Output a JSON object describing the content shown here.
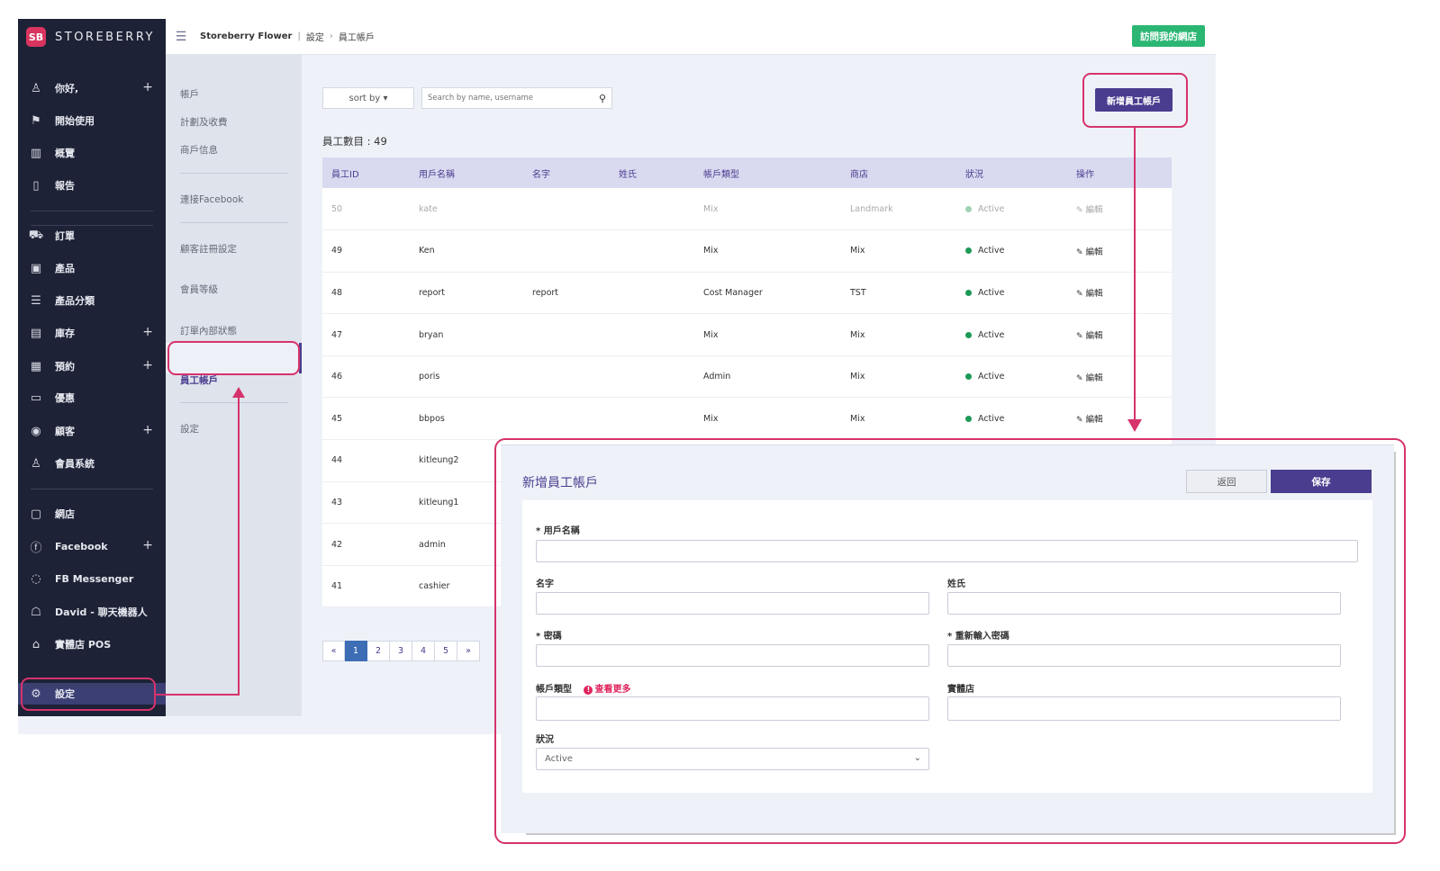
{
  "brand": {
    "logo": "SB",
    "name": "STOREBERRY"
  },
  "sidebar": {
    "items": [
      {
        "icon": "user-icon",
        "glyph": "♙",
        "label": "你好,",
        "plus": true
      },
      {
        "icon": "flag-icon",
        "glyph": "⚑",
        "label": "開始使用",
        "plus": false
      },
      {
        "icon": "chart-icon",
        "glyph": "▥",
        "label": "概覽",
        "plus": false
      },
      {
        "icon": "document-icon",
        "glyph": "▯",
        "label": "報告",
        "plus": false
      },
      {
        "icon": "cart-icon",
        "glyph": "⛟",
        "label": "訂單",
        "plus": false
      },
      {
        "icon": "product-icon",
        "glyph": "▣",
        "label": "產品",
        "plus": false
      },
      {
        "icon": "list-icon",
        "glyph": "☰",
        "label": "產品分類",
        "plus": false
      },
      {
        "icon": "inventory-icon",
        "glyph": "▤",
        "label": "庫存",
        "plus": true
      },
      {
        "icon": "calendar-icon",
        "glyph": "▦",
        "label": "預約",
        "plus": true
      },
      {
        "icon": "coupon-icon",
        "glyph": "▭",
        "label": "優惠",
        "plus": false
      },
      {
        "icon": "customer-icon",
        "glyph": "◉",
        "label": "顧客",
        "plus": true
      },
      {
        "icon": "membership-icon",
        "glyph": "♙",
        "label": "會員系統",
        "plus": false
      },
      {
        "icon": "webshop-icon",
        "glyph": "▢",
        "label": "網店",
        "plus": false
      },
      {
        "icon": "facebook-icon",
        "glyph": "ⓕ",
        "label": "Facebook",
        "plus": true
      },
      {
        "icon": "messenger-icon",
        "glyph": "◌",
        "label": "FB Messenger",
        "plus": false
      },
      {
        "icon": "chatbot-icon",
        "glyph": "☖",
        "label": "David - 聊天機器人",
        "plus": false
      },
      {
        "icon": "store-icon",
        "glyph": "⌂",
        "label": "實體店 POS",
        "plus": false
      },
      {
        "icon": "gear-icon",
        "glyph": "⚙",
        "label": "設定",
        "plus": false
      }
    ]
  },
  "subnav": {
    "items": [
      "帳戶",
      "計劃及收費",
      "商戶信息",
      "連接Facebook",
      "顧客註冊設定",
      "會員等級",
      "訂單內部狀態",
      "員工帳戶",
      "設定"
    ]
  },
  "topbar": {
    "breadcrumb": [
      "Storeberry Flower",
      "設定",
      "員工帳戶"
    ],
    "visit_label": "訪問我的網店"
  },
  "toolbar": {
    "sort_label": "sort by ▾",
    "search_placeholder": "Search by name, username",
    "add_label": "新增員工帳戶",
    "count_label": "員工數目 : 49"
  },
  "table": {
    "columns": [
      "員工ID",
      "用戶名稱",
      "名字",
      "姓氏",
      "帳戶類型",
      "商店",
      "狀況",
      "操作"
    ],
    "rows": [
      {
        "id": "50",
        "username": "kate",
        "first": "",
        "last": "",
        "type": "Mix",
        "store": "Landmark",
        "status": "Active",
        "action": "編輯"
      },
      {
        "id": "49",
        "username": "Ken",
        "first": "",
        "last": "",
        "type": "Mix",
        "store": "Mix",
        "status": "Active",
        "action": "編輯"
      },
      {
        "id": "48",
        "username": "report",
        "first": "report",
        "last": "",
        "type": "Cost Manager",
        "store": "TST",
        "status": "Active",
        "action": "編輯"
      },
      {
        "id": "47",
        "username": "bryan",
        "first": "",
        "last": "",
        "type": "Mix",
        "store": "Mix",
        "status": "Active",
        "action": "編輯"
      },
      {
        "id": "46",
        "username": "poris",
        "first": "",
        "last": "",
        "type": "Admin",
        "store": "Mix",
        "status": "Active",
        "action": "編輯"
      },
      {
        "id": "45",
        "username": "bbpos",
        "first": "",
        "last": "",
        "type": "Mix",
        "store": "Mix",
        "status": "Active",
        "action": "編輯"
      },
      {
        "id": "44",
        "username": "kitleung2",
        "first": "",
        "last": "",
        "type": "",
        "store": "",
        "status": "",
        "action": ""
      },
      {
        "id": "43",
        "username": "kitleung1",
        "first": "",
        "last": "",
        "type": "",
        "store": "",
        "status": "",
        "action": ""
      },
      {
        "id": "42",
        "username": "admin",
        "first": "",
        "last": "",
        "type": "",
        "store": "",
        "status": "",
        "action": ""
      },
      {
        "id": "41",
        "username": "cashier",
        "first": "",
        "last": "",
        "type": "",
        "store": "",
        "status": "",
        "action": ""
      }
    ]
  },
  "pagination": {
    "prev": "«",
    "pages": [
      "1",
      "2",
      "3",
      "4",
      "5"
    ],
    "next": "»",
    "current": "1"
  },
  "form": {
    "title": "新增員工帳戶",
    "back_label": "返回",
    "save_label": "保存",
    "username_label": "* 用戶名稱",
    "first_label": "名字",
    "last_label": "姓氏",
    "password_label": "* 密碼",
    "password2_label": "* 重新輸入密碼",
    "type_label": "帳戶類型",
    "more_label": "查看更多",
    "store_label": "實體店",
    "status_label": "狀況",
    "status_value": "Active"
  },
  "colors": {
    "accent": "#4a3d8f",
    "sidebar": "#1d2236",
    "success": "#2bb673",
    "highlight": "#d6336c"
  }
}
